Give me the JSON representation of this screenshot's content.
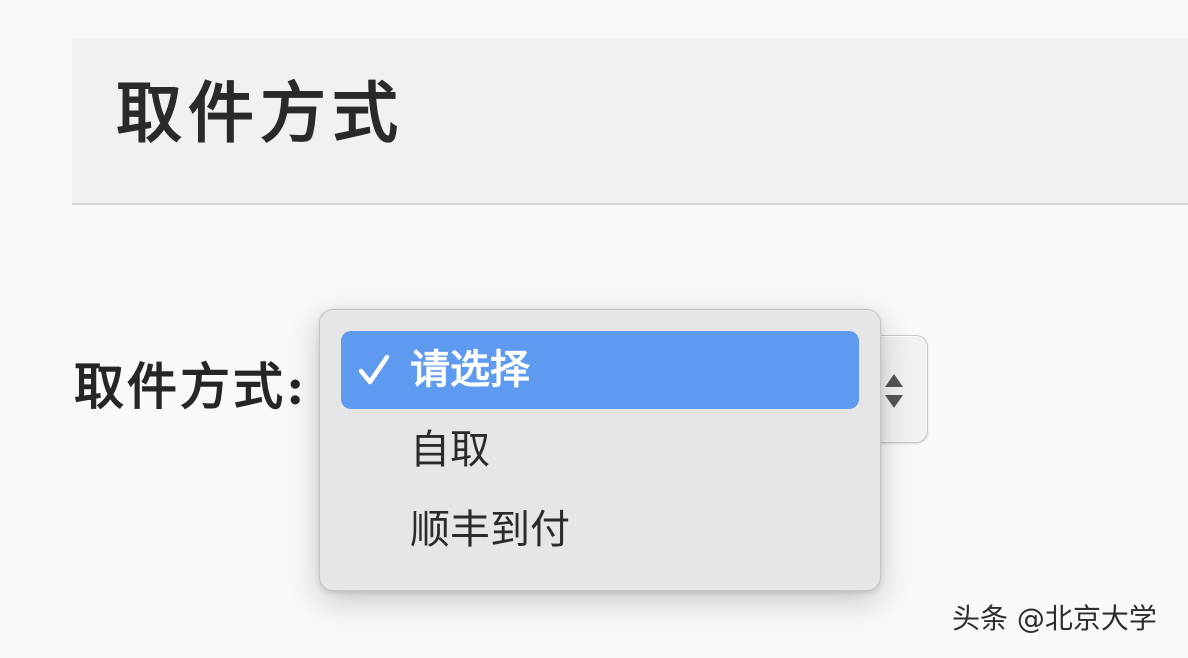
{
  "header": {
    "title": "取件方式"
  },
  "form": {
    "pickup_label": "取件方式:",
    "pickup_select": {
      "selected_value": "请选择",
      "options": [
        {
          "label": "请选择",
          "selected": true
        },
        {
          "label": "自取",
          "selected": false
        },
        {
          "label": "顺丰到付",
          "selected": false
        }
      ]
    }
  },
  "icons": {
    "selected_check": "checkmark-icon",
    "select_arrows": "up-down-stepper-icon"
  },
  "colors": {
    "highlight": "#5e9bf0",
    "header_background": "#f1f0f2",
    "menu_background": "#e6e5e8"
  },
  "watermark": "头条 @北京大学"
}
